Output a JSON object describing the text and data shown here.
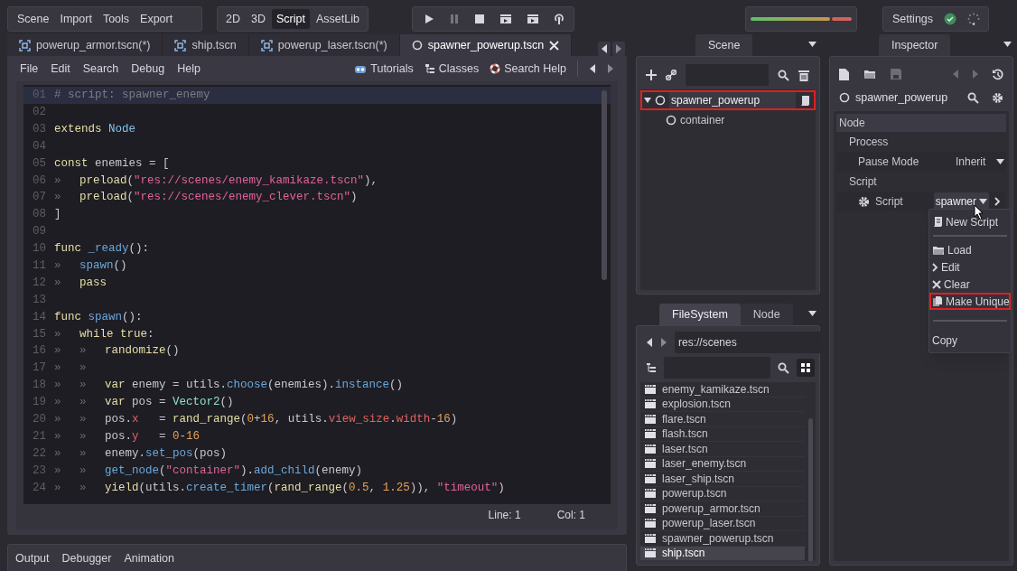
{
  "menu": [
    "Scene",
    "Import",
    "Tools",
    "Export"
  ],
  "modes": [
    {
      "label": "2D",
      "selected": false
    },
    {
      "label": "3D",
      "selected": false
    },
    {
      "label": "Script",
      "selected": true
    },
    {
      "label": "AssetLib",
      "selected": false
    }
  ],
  "settings": {
    "label": "Settings"
  },
  "file_tabs": [
    {
      "kind": "scene",
      "label": "powerup_armor.tscn(*)",
      "selected": false
    },
    {
      "kind": "scene",
      "label": "ship.tscn",
      "selected": false
    },
    {
      "kind": "scene",
      "label": "powerup_laser.tscn(*)",
      "selected": false
    },
    {
      "kind": "script",
      "label": "spawner_powerup.tscn",
      "selected": true
    }
  ],
  "script_menu": [
    "File",
    "Edit",
    "Search",
    "Debug",
    "Help"
  ],
  "script_tools": [
    {
      "kind": "tutorials",
      "label": "Tutorials"
    },
    {
      "kind": "classes",
      "label": "Classes"
    },
    {
      "kind": "help",
      "label": "Search Help"
    }
  ],
  "code": [
    {
      "num": "01",
      "current": true,
      "tokens": [
        {
          "kind": "comment",
          "text": "# script: spawner_enemy"
        }
      ]
    },
    {
      "num": "02",
      "current": false
    },
    {
      "num": "03",
      "current": false,
      "tokens": [
        {
          "kind": "keyword",
          "text": "extends"
        },
        {
          "kind": "type",
          "text": " Node"
        }
      ]
    },
    {
      "num": "04",
      "current": false
    },
    {
      "num": "05",
      "current": false,
      "tokens": [
        {
          "kind": "keyword",
          "text": "const"
        },
        {
          "kind": "plain",
          "text": " enemies = ["
        }
      ]
    },
    {
      "num": "06",
      "current": false,
      "tokens": [
        {
          "kind": "tab",
          "text": "»"
        },
        {
          "kind": "keyword",
          "text": "preload"
        },
        {
          "kind": "plain",
          "text": "("
        },
        {
          "kind": "string",
          "text": "\"res://scenes/enemy_kamikaze.tscn\""
        },
        {
          "kind": "plain",
          "text": "),"
        }
      ]
    },
    {
      "num": "07",
      "current": false,
      "tokens": [
        {
          "kind": "tab",
          "text": "»"
        },
        {
          "kind": "keyword",
          "text": "preload"
        },
        {
          "kind": "plain",
          "text": "("
        },
        {
          "kind": "string",
          "text": "\"res://scenes/enemy_clever.tscn\""
        },
        {
          "kind": "plain",
          "text": ")"
        }
      ]
    },
    {
      "num": "08",
      "current": false,
      "tokens": [
        {
          "kind": "plain",
          "text": "]"
        }
      ]
    },
    {
      "num": "09",
      "current": false
    },
    {
      "num": "10",
      "current": false,
      "tokens": [
        {
          "kind": "keyword",
          "text": "func"
        },
        {
          "kind": "function",
          "text": " _ready"
        },
        {
          "kind": "plain",
          "text": "():"
        }
      ]
    },
    {
      "num": "11",
      "current": false,
      "tokens": [
        {
          "kind": "tab",
          "text": "»"
        },
        {
          "kind": "function",
          "text": "spawn"
        },
        {
          "kind": "plain",
          "text": "()"
        }
      ]
    },
    {
      "num": "12",
      "current": false,
      "tokens": [
        {
          "kind": "tab",
          "text": "»"
        },
        {
          "kind": "keyword",
          "text": "pass"
        }
      ]
    },
    {
      "num": "13",
      "current": false
    },
    {
      "num": "14",
      "current": false,
      "tokens": [
        {
          "kind": "keyword",
          "text": "func"
        },
        {
          "kind": "function",
          "text": " spawn"
        },
        {
          "kind": "plain",
          "text": "():"
        }
      ]
    },
    {
      "num": "15",
      "current": false,
      "tokens": [
        {
          "kind": "tab",
          "text": "»"
        },
        {
          "kind": "keyword",
          "text": "while true"
        },
        {
          "kind": "plain",
          "text": ":"
        }
      ]
    },
    {
      "num": "16",
      "current": false,
      "tokens": [
        {
          "kind": "tab",
          "text": "»"
        },
        {
          "kind": "tab",
          "text": "»"
        },
        {
          "kind": "keyword",
          "text": "randomize"
        },
        {
          "kind": "plain",
          "text": "()"
        }
      ]
    },
    {
      "num": "17",
      "current": false,
      "tokens": [
        {
          "kind": "tab",
          "text": "»"
        },
        {
          "kind": "tab",
          "text": "»"
        }
      ]
    },
    {
      "num": "18",
      "current": false,
      "tokens": [
        {
          "kind": "tab",
          "text": "»"
        },
        {
          "kind": "tab",
          "text": "»"
        },
        {
          "kind": "keyword",
          "text": "var"
        },
        {
          "kind": "plain",
          "text": " enemy = utils."
        },
        {
          "kind": "function",
          "text": "choose"
        },
        {
          "kind": "plain",
          "text": "(enemies)."
        },
        {
          "kind": "function",
          "text": "instance"
        },
        {
          "kind": "plain",
          "text": "()"
        }
      ]
    },
    {
      "num": "19",
      "current": false,
      "tokens": [
        {
          "kind": "tab",
          "text": "»"
        },
        {
          "kind": "tab",
          "text": "»"
        },
        {
          "kind": "keyword",
          "text": "var"
        },
        {
          "kind": "plain",
          "text": " pos = "
        },
        {
          "kind": "class",
          "text": "Vector2"
        },
        {
          "kind": "plain",
          "text": "()"
        }
      ]
    },
    {
      "num": "20",
      "current": false,
      "tokens": [
        {
          "kind": "tab",
          "text": "»"
        },
        {
          "kind": "tab",
          "text": "»"
        },
        {
          "kind": "plain",
          "text": "pos."
        },
        {
          "kind": "member",
          "text": "x"
        },
        {
          "kind": "plain",
          "text": "   = "
        },
        {
          "kind": "keyword",
          "text": "rand_range"
        },
        {
          "kind": "plain",
          "text": "("
        },
        {
          "kind": "number",
          "text": "0"
        },
        {
          "kind": "plain",
          "text": "+"
        },
        {
          "kind": "number",
          "text": "16"
        },
        {
          "kind": "plain",
          "text": ", utils."
        },
        {
          "kind": "member",
          "text": "view_size"
        },
        {
          "kind": "plain",
          "text": "."
        },
        {
          "kind": "member",
          "text": "width"
        },
        {
          "kind": "plain",
          "text": "-"
        },
        {
          "kind": "number",
          "text": "16"
        },
        {
          "kind": "plain",
          "text": ")"
        }
      ]
    },
    {
      "num": "21",
      "current": false,
      "tokens": [
        {
          "kind": "tab",
          "text": "»"
        },
        {
          "kind": "tab",
          "text": "»"
        },
        {
          "kind": "plain",
          "text": "pos."
        },
        {
          "kind": "member",
          "text": "y"
        },
        {
          "kind": "plain",
          "text": "   = "
        },
        {
          "kind": "number",
          "text": "0"
        },
        {
          "kind": "plain",
          "text": "-"
        },
        {
          "kind": "number",
          "text": "16"
        }
      ]
    },
    {
      "num": "22",
      "current": false,
      "tokens": [
        {
          "kind": "tab",
          "text": "»"
        },
        {
          "kind": "tab",
          "text": "»"
        },
        {
          "kind": "plain",
          "text": "enemy."
        },
        {
          "kind": "function",
          "text": "set_pos"
        },
        {
          "kind": "plain",
          "text": "(pos)"
        }
      ]
    },
    {
      "num": "23",
      "current": false,
      "tokens": [
        {
          "kind": "tab",
          "text": "»"
        },
        {
          "kind": "tab",
          "text": "»"
        },
        {
          "kind": "function",
          "text": "get_node"
        },
        {
          "kind": "plain",
          "text": "("
        },
        {
          "kind": "string",
          "text": "\"container\""
        },
        {
          "kind": "plain",
          "text": ")."
        },
        {
          "kind": "function",
          "text": "add_child"
        },
        {
          "kind": "plain",
          "text": "(enemy)"
        }
      ]
    },
    {
      "num": "24",
      "current": false,
      "tokens": [
        {
          "kind": "tab",
          "text": "»"
        },
        {
          "kind": "tab",
          "text": "»"
        },
        {
          "kind": "keyword",
          "text": "yield"
        },
        {
          "kind": "plain",
          "text": "(utils."
        },
        {
          "kind": "function",
          "text": "create_timer"
        },
        {
          "kind": "plain",
          "text": "("
        },
        {
          "kind": "keyword",
          "text": "rand_range"
        },
        {
          "kind": "plain",
          "text": "("
        },
        {
          "kind": "number",
          "text": "0.5"
        },
        {
          "kind": "plain",
          "text": ", "
        },
        {
          "kind": "number",
          "text": "1.25"
        },
        {
          "kind": "plain",
          "text": ")), "
        },
        {
          "kind": "string",
          "text": "\"timeout\""
        },
        {
          "kind": "plain",
          "text": ")"
        }
      ]
    }
  ],
  "editor_status": {
    "line": "Line: 1",
    "col": "Col: 1"
  },
  "bottom_tabs": [
    "Output",
    "Debugger",
    "Animation"
  ],
  "scene_dock": {
    "tab": "Scene",
    "tree": [
      {
        "label": "spawner_powerup",
        "expanded": true,
        "highlighted": true,
        "children": [
          {
            "label": "container",
            "highlighted": false
          }
        ]
      }
    ]
  },
  "file_dock": {
    "tabs": [
      {
        "label": "FileSystem",
        "selected": true
      },
      {
        "label": "Node",
        "selected": false
      }
    ],
    "path": "res://scenes",
    "files": [
      {
        "label": "enemy_kamikaze.tscn",
        "selected": false
      },
      {
        "label": "explosion.tscn",
        "selected": false
      },
      {
        "label": "flare.tscn",
        "selected": false
      },
      {
        "label": "flash.tscn",
        "selected": false
      },
      {
        "label": "laser.tscn",
        "selected": false
      },
      {
        "label": "laser_enemy.tscn",
        "selected": false
      },
      {
        "label": "laser_ship.tscn",
        "selected": false
      },
      {
        "label": "powerup.tscn",
        "selected": false
      },
      {
        "label": "powerup_armor.tscn",
        "selected": false
      },
      {
        "label": "powerup_laser.tscn",
        "selected": false
      },
      {
        "label": "spawner_powerup.tscn",
        "selected": false
      },
      {
        "label": "ship.tscn",
        "selected": true
      }
    ]
  },
  "inspector": {
    "tab": "Inspector",
    "object": "spawner_powerup",
    "rows": [
      {
        "kind": "section",
        "label": "Node"
      },
      {
        "kind": "category",
        "label": "Process"
      },
      {
        "kind": "property",
        "label": "Pause Mode",
        "value": "Inherit"
      },
      {
        "kind": "category",
        "label": "Script"
      },
      {
        "kind": "resource",
        "label": "Script",
        "value": "spawner"
      }
    ]
  },
  "popup_menu": [
    {
      "label": "New Script",
      "separator_before": false,
      "highlighted": false
    },
    {
      "label": "Load",
      "separator_before": true,
      "highlighted": false
    },
    {
      "label": "Edit",
      "separator_before": false,
      "highlighted": false
    },
    {
      "label": "Clear",
      "separator_before": false,
      "highlighted": false
    },
    {
      "label": "Make Unique",
      "separator_before": false,
      "highlighted": true
    },
    {
      "label": "Copy",
      "separator_before": true,
      "highlighted": false
    }
  ]
}
